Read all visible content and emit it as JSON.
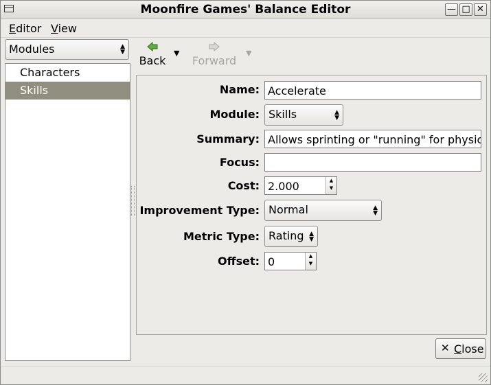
{
  "window": {
    "title": "Moonfire Games' Balance Editor"
  },
  "menubar": {
    "items": [
      {
        "label": "Editor",
        "mnemonic": "E",
        "rest": "ditor"
      },
      {
        "label": "View",
        "mnemonic": "V",
        "rest": "iew"
      }
    ]
  },
  "sidebar": {
    "selector": {
      "value": "Modules"
    },
    "items": [
      {
        "label": "Characters",
        "selected": false
      },
      {
        "label": "Skills",
        "selected": true
      }
    ]
  },
  "toolbar": {
    "back": {
      "label": "Back",
      "icon": "back-arrow-icon",
      "enabled": true
    },
    "forward": {
      "label": "Forward",
      "icon": "forward-arrow-icon",
      "enabled": false
    }
  },
  "form": {
    "name": {
      "label": "Name:",
      "value": "Accelerate"
    },
    "module": {
      "label": "Module:",
      "value": "Skills"
    },
    "summary": {
      "label": "Summary:",
      "value": "Allows sprinting or \"running\" for physica"
    },
    "focus": {
      "label": "Focus:",
      "value": ""
    },
    "cost": {
      "label": "Cost:",
      "value": "2.000"
    },
    "improvement_type": {
      "label": "Improvement Type:",
      "value": "Normal"
    },
    "metric_type": {
      "label": "Metric Type:",
      "value": "Rating"
    },
    "offset": {
      "label": "Offset:",
      "value": "0"
    }
  },
  "footer": {
    "close": {
      "label": "Close",
      "mnemonic": "C",
      "rest": "lose",
      "icon": "close-x-icon"
    }
  },
  "colors": {
    "selection": "#8f8e7f",
    "background": "#ecebe7",
    "back_icon": "#3d8a2a"
  }
}
